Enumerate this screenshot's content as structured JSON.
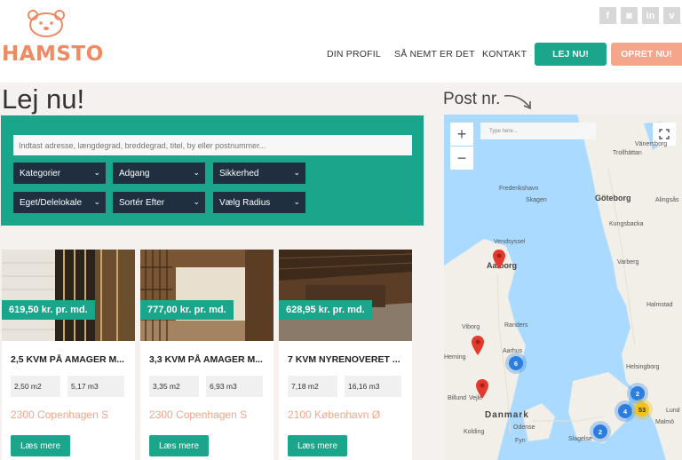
{
  "brand": {
    "name": "HAMSTO"
  },
  "social": [
    "f",
    "◙",
    "in",
    "v"
  ],
  "nav": {
    "links": [
      "DIN PROFIL",
      "SÅ NEMT ER DET",
      "KONTAKT"
    ],
    "cta_primary": "LEJ NU!",
    "cta_secondary": "OPRET NU!"
  },
  "page": {
    "title": "Lej nu!",
    "post_label": "Post nr."
  },
  "filter": {
    "search_placeholder": "Indtast adresse, længdegrad, breddegrad, titel, by eller postnummer...",
    "dropdowns": [
      "Kategorier",
      "Adgang",
      "Sikkerhed",
      "Eget/Delelokale",
      "Sortér Efter",
      "Vælg Radius"
    ]
  },
  "listings": [
    {
      "price": "619,50 kr. pr. md.",
      "title": "2,5 KVM PÅ AMAGER M...",
      "area": "2,50 m2",
      "volume": "5,17 m3",
      "city": "2300 Copenhagen S",
      "button": "Læs mere"
    },
    {
      "price": "777,00 kr. pr. md.",
      "title": "3,3 KVM PÅ AMAGER M...",
      "area": "3,35 m2",
      "volume": "6,93 m3",
      "city": "2300 Copenhagen S",
      "button": "Læs mere"
    },
    {
      "price": "628,95 kr. pr. md.",
      "title": "7 KVM NYRENOVERET ...",
      "area": "7,18 m2",
      "volume": "16,16 m3",
      "city": "2100 København Ø",
      "button": "Læs mere"
    }
  ],
  "map": {
    "search_placeholder": "Type here...",
    "zoom_in": "+",
    "zoom_out": "−",
    "labels": {
      "trollhattan": "Trollhättan",
      "frederikshavn": "Frederikshavn",
      "skagen": "Skagen",
      "goteborg": "Göteborg",
      "vanersborg": "Vänersborg",
      "alingsas": "Alingsås",
      "kungsbacka": "Kungsbacka",
      "vendsyssel": "Vendsyssel",
      "aalborg": "Aalborg",
      "varberg": "Varberg",
      "viborg": "Viborg",
      "randers": "Randers",
      "aarhus": "Aarhus",
      "halmstad": "Halmstad",
      "herning": "Herning",
      "helsingborg": "Helsingborg",
      "vejle": "Vejle",
      "billund": "Billund",
      "danmark": "Danmark",
      "kolding": "Kolding",
      "odense": "Odense",
      "fyn": "Fyn",
      "slagelse": "Slagelse",
      "malmo": "Malmö",
      "lund": "Lund"
    },
    "clusters": [
      "6",
      "2",
      "4",
      "53",
      "2"
    ]
  },
  "colors": {
    "teal": "#1aa68a",
    "salmon": "#f4a58a",
    "navy": "#1f2f40",
    "water": "#aadaff",
    "land": "#f2efe8"
  }
}
